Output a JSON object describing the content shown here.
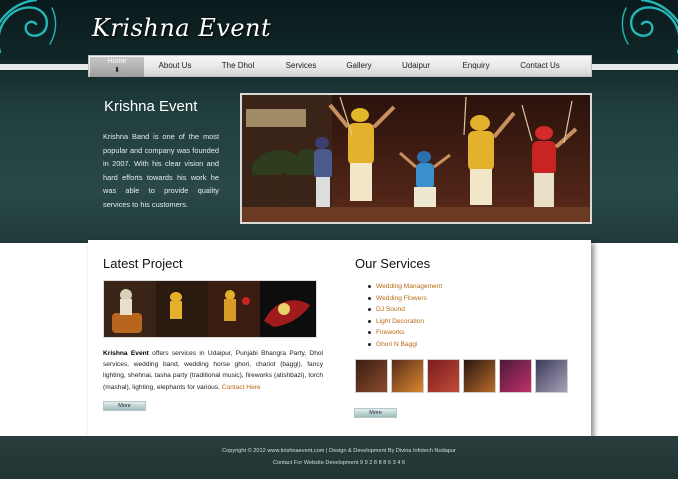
{
  "header": {
    "site_title": "Krishna Event"
  },
  "nav": {
    "items": [
      {
        "label": "Home"
      },
      {
        "label": "About Us"
      },
      {
        "label": "The Dhol"
      },
      {
        "label": "Services"
      },
      {
        "label": "Gallery"
      },
      {
        "label": "Udaipur"
      },
      {
        "label": "Enquiry"
      },
      {
        "label": "Contact Us"
      }
    ],
    "active": "Home"
  },
  "intro": {
    "title": "Krishna Event",
    "text": "Krishna Band is one of the most popular and company was founded in 2007. With his clear vision and hard efforts towards his work he was able to provide quality services to his customers."
  },
  "latest_project": {
    "title": "Latest Project",
    "lead": "Krishna Event",
    "text": " offers services in Udaipur, Punjabi Bhangra Party, Dhol services, wedding band, wedding horse ghori, chariot (baggi), fancy lighting, shehnai, tasha party (traditional music), fireworks (atishbazi), torch (mashal), lighting, elephants for various. ",
    "link": "Contact Here",
    "more_label": "More"
  },
  "our_services": {
    "title": "Our Services",
    "items": [
      "Wedding Management",
      "Wedding Flowers",
      "DJ Sound",
      "Light Decoration",
      "Fireworks",
      "Ghori N Baggi"
    ],
    "more_label": "More"
  },
  "footer": {
    "copyright": "Copyright © 2012 www.krishnaevent.com | Design & Development By Divina Infotech Nodapur",
    "contact": "Contact For Website Development 9 9 2 8 8 8 6 3 4 6"
  },
  "colors": {
    "header_bg": "#213e3e",
    "accent_teal": "#1fb4b4",
    "link_orange": "#b96a12",
    "footer_bg": "#213434"
  }
}
